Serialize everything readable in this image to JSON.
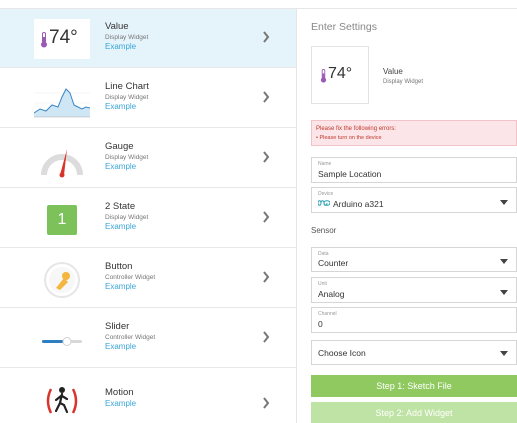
{
  "widgets": [
    {
      "name": "Value",
      "type": "Display Widget",
      "example": "Example",
      "thumb_text": "74°",
      "selected": true
    },
    {
      "name": "Line Chart",
      "type": "Display Widget",
      "example": "Example"
    },
    {
      "name": "Gauge",
      "type": "Display Widget",
      "example": "Example"
    },
    {
      "name": "2 State",
      "type": "Display Widget",
      "example": "Example",
      "thumb_text": "1"
    },
    {
      "name": "Button",
      "type": "Controller Widget",
      "example": "Example"
    },
    {
      "name": "Slider",
      "type": "Controller Widget",
      "example": "Example"
    },
    {
      "name": "Motion",
      "type": "",
      "example": "Example"
    }
  ],
  "settings": {
    "title": "Enter Settings",
    "preview": {
      "value": "74°",
      "name": "Value",
      "type": "Display Widget"
    },
    "error": {
      "title": "Please fix the following errors:",
      "item": "Please turn on the device"
    },
    "name_field": {
      "label": "Name",
      "value": "Sample Location"
    },
    "device_field": {
      "label": "Device",
      "value": "Arduino a321"
    },
    "sensor_heading": "Sensor",
    "data_field": {
      "label": "Data",
      "value": "Counter"
    },
    "unit_field": {
      "label": "Unit",
      "value": "Analog"
    },
    "channel_field": {
      "label": "Channel",
      "value": "0"
    },
    "icon_field": {
      "value": "Choose Icon"
    },
    "step1_label": "Step 1: Sketch File",
    "step2_label": "Step 2: Add Widget"
  },
  "colors": {
    "accent_blue": "#3ba6d9",
    "green": "#8fc960",
    "green_light": "#bfe3a4",
    "error_text": "#c0392b",
    "selected_row": "#e5f3fb"
  }
}
